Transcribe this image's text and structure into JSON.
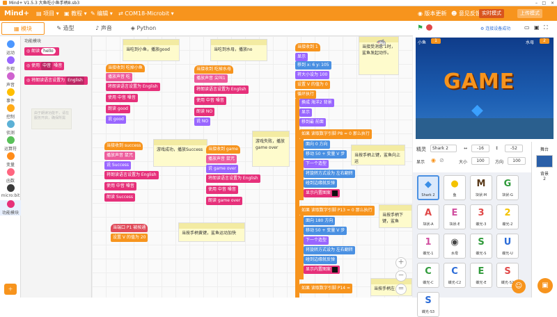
{
  "window": {
    "title": "Mind+ V1.5.3    大鱼吃小鱼手柄8.sb3"
  },
  "menu": {
    "logo": "Mind+",
    "items": [
      "项目",
      "教程",
      "编辑",
      "COM18-Microbit"
    ],
    "right": [
      "版本更新",
      "意见反馈"
    ],
    "mode": [
      "实时模式",
      "上传模式"
    ]
  },
  "tabs": [
    "模块",
    "造型",
    "声音",
    "Python"
  ],
  "categories": [
    "运动",
    "外观",
    "声音",
    "事件",
    "控制",
    "侦测",
    "运算符",
    "变量",
    "函数",
    "micro:bit",
    "功能模块"
  ],
  "palette": {
    "header": "功能模块",
    "blocks": [
      {
        "label": "朗读",
        "value": "hello"
      },
      {
        "label": "使用",
        "value": "中音",
        "tail": "嗓音"
      },
      {
        "label": "将朗读语言设置为",
        "value": "English"
      }
    ],
    "blurred_note": "由于朗读功能不，请在服务开启，确保所需"
  },
  "stage_header": {
    "connected": "连接设备成功"
  },
  "stage": {
    "game_text": "GAME",
    "left_label": "小鱼",
    "left_value": "1",
    "right_label": "水母",
    "right_value": "2"
  },
  "sprite_info": {
    "sprite_label": "精灵",
    "sprite_name": "Shark 2",
    "x": "-16",
    "y": "-52",
    "show_label": "显示",
    "size_label": "大小",
    "size_value": "100",
    "dir_label": "方向",
    "dir_value": "100"
  },
  "sprites": [
    "Shark 2",
    "鱼",
    "块状-M",
    "块状-G",
    "块状-A",
    "块状-E",
    "蝶光-3",
    "蝶光-2",
    "蝶光-1",
    "水母",
    "蝶光-S",
    "蝶光-U",
    "蝶光-C",
    "蝶光-C2",
    "蝶光-E",
    "蝶光-S2",
    "蝶光-S3"
  ],
  "sprite_icons": [
    "◆",
    "●",
    "M",
    "G",
    "A",
    "E",
    "3",
    "2",
    "1",
    "◉",
    "S",
    "U",
    "C",
    "C",
    "E",
    "S",
    "S"
  ],
  "stage_panel": {
    "label": "舞台",
    "bg_label": "背景",
    "bg_count": "2"
  },
  "scripts": {
    "s1": {
      "hat": "当接收到 吃掉小鱼",
      "ctx": "播放声音 吃",
      "lang": "将朗读语言设置为 English",
      "use": "使用 中音 嗓音",
      "say": "朗读 good",
      "b5": "说 good"
    },
    "s2": {
      "hat": "当接收到 吃掉水母",
      "ctx": "播放声音 尖叫1",
      "lang": "将朗读语言设置为 English",
      "use": "使用 中音 嗓音",
      "say": "朗读 NO",
      "b5": "说 NO"
    },
    "s3": {
      "hat": "当接收到 success",
      "ctx": "播放声音 鼠咒",
      "b3": "说 Success",
      "lang": "将朗读语言设置为 English",
      "use": "使用 中音 嗓音",
      "say": "朗读 Success"
    },
    "s4": {
      "hat": "当接收到 game",
      "ctx": "播放声音 鼠咒",
      "b3": "说 game over",
      "lang": "将朗读语言设置为 English",
      "use": "使用 中音 嗓音",
      "say": "朗读 game over"
    },
    "s5": {
      "hat": "当端口 P1 被按通",
      "b2": "设置 V 的值为 20"
    },
    "main": {
      "hat": "当接收到 1",
      "b1": "显示",
      "b2": "移到 x: 6  y: 105",
      "b3": "将大小设为 100",
      "b4": "设置 V 的值为 0",
      "b5": "循环执行",
      "b6": "换成 海洋2 背景",
      "b7": "显示",
      "b8": "移到最 前面",
      "if1": "如果  读取数字引脚 P8 = 0  那么执行",
      "d1": "面向 0 方向",
      "d2": "移动 50 + 变量 V 步",
      "d3": "下一个造型",
      "d4": "将旋转方式设为 左右翻转",
      "d5": "碰到边缘就反弹",
      "d6": "显示内置图案",
      "if2": "如果  读取数字引脚 P13 = 0  那么执行",
      "e1": "面向 180 方向",
      "e2": "移动 50 + 变量 V 步",
      "e3": "下一个造型",
      "e4": "将旋转方式设为 左右翻转",
      "e5": "碰到边缘就反弹",
      "e6": "显示内置图案",
      "if3": "如果  读取数字引脚 P14 ="
    }
  },
  "notes": {
    "n1": "当吃到小鱼，播放good",
    "n2": "当吃到水母，播放no",
    "n3": "当接受消息 1时，鲨鱼发起动作。",
    "n4": "游戏成功，播放Success",
    "n5": "游戏失败，播放game over",
    "n6": "当按手柄上键，鲨鱼向上运",
    "n7": "当按手柄下键，鲨鱼",
    "n8": "当按手柄黄键，鲨鱼运动加快",
    "n9": "当按手柄左"
  }
}
